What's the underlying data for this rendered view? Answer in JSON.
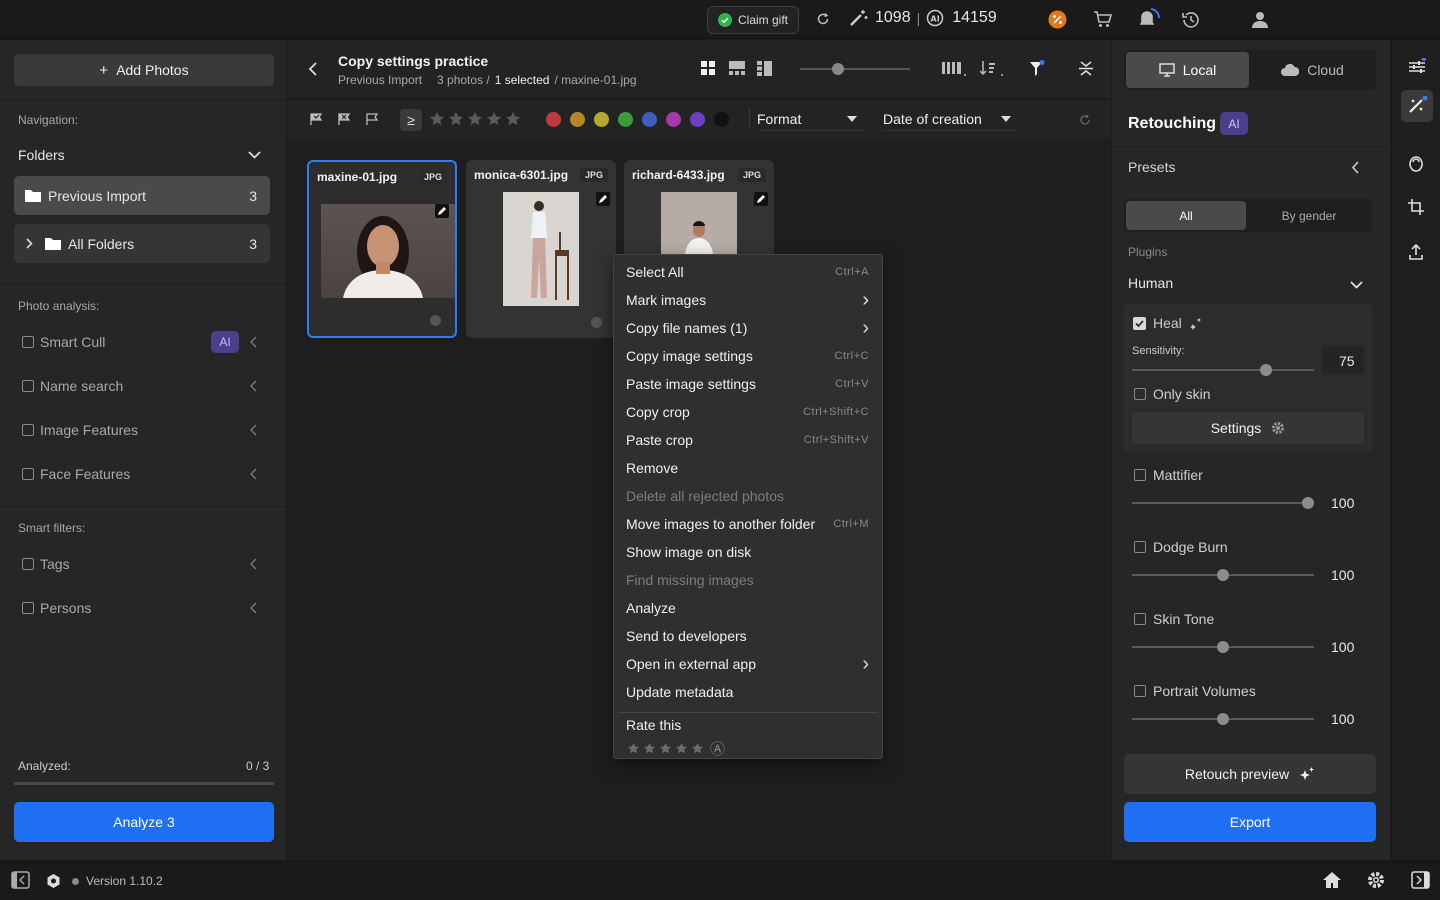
{
  "topbar": {
    "claim_gift": "Claim gift",
    "credits_a": "1098",
    "separator": "|",
    "credits_b": "14159"
  },
  "left": {
    "add_photos": "Add Photos",
    "navigation_label": "Navigation:",
    "folders_label": "Folders",
    "previous_import": "Previous Import",
    "previous_import_count": "3",
    "all_folders": "All Folders",
    "all_folders_count": "3",
    "photo_analysis_label": "Photo analysis:",
    "smart_cull": "Smart Cull",
    "ai_badge": "AI",
    "name_search": "Name search",
    "image_features": "Image Features",
    "face_features": "Face Features",
    "smart_filters_label": "Smart filters:",
    "tags": "Tags",
    "persons": "Persons",
    "analyzed_label": "Analyzed:",
    "analyzed_value": "0 / 3",
    "analyzed_progress": 0,
    "analyze_button": "Analyze 3"
  },
  "header": {
    "title": "Copy settings practice",
    "folder": "Previous Import",
    "photos": "3 photos /",
    "selected": "1 selected",
    "file": "/ maxine-01.jpg",
    "zoom_level": 0.3
  },
  "filterbar": {
    "gte": "≥",
    "format": "Format",
    "date": "Date of creation",
    "color_labels": [
      "#c0393b",
      "#b8862a",
      "#b5a82a",
      "#3a9a3d",
      "#3f5fc0",
      "#a23aa8",
      "#6a40c0",
      "#111111"
    ]
  },
  "cards": [
    {
      "name": "maxine-01.jpg",
      "badge": "JPG"
    },
    {
      "name": "monica-6301.jpg",
      "badge": "JPG"
    },
    {
      "name": "richard-6433.jpg",
      "badge": "JPG"
    }
  ],
  "context_menu": {
    "items": [
      {
        "label": "Select All",
        "shortcut": "Ctrl+A"
      },
      {
        "label": "Mark images",
        "arrow": "›"
      },
      {
        "label": "Copy file names (1)",
        "arrow": "›"
      },
      {
        "label": "Copy image settings",
        "shortcut": "Ctrl+C"
      },
      {
        "label": "Paste image settings",
        "shortcut": "Ctrl+V"
      },
      {
        "label": "Copy crop",
        "shortcut": "Ctrl+Shift+C"
      },
      {
        "label": "Paste crop",
        "shortcut": "Ctrl+Shift+V"
      },
      {
        "label": "Remove"
      },
      {
        "label": "Delete all rejected photos",
        "disabled": true
      },
      {
        "label": "Move images to another folder",
        "shortcut": "Ctrl+M"
      },
      {
        "label": "Show image on disk"
      },
      {
        "label": "Find missing images",
        "disabled": true
      },
      {
        "label": "Analyze"
      },
      {
        "label": "Send to developers"
      },
      {
        "label": "Open in external app",
        "arrow": "›"
      },
      {
        "label": "Update metadata"
      }
    ],
    "rate_this": "Rate this",
    "auto_rating": "Ⓐ"
  },
  "right": {
    "local": "Local",
    "cloud": "Cloud",
    "retouching": "Retouching",
    "ai_badge": "AI",
    "presets": "Presets",
    "all": "All",
    "by_gender": "By gender",
    "plugins_label": "Plugins",
    "human": "Human",
    "heal": "Heal",
    "sensitivity_label": "Sensitivity:",
    "sensitivity_value": "75",
    "only_skin": "Only skin",
    "settings": "Settings",
    "mattifier": "Mattifier",
    "mattifier_value": "100",
    "dodge_burn": "Dodge Burn",
    "dodge_burn_value": "100",
    "skin_tone": "Skin Tone",
    "skin_tone_value": "100",
    "portrait_volumes": "Portrait Volumes",
    "portrait_volumes_value": "100",
    "retouch_preview": "Retouch preview",
    "export": "Export"
  },
  "bottom": {
    "version": "Version 1.10.2"
  }
}
